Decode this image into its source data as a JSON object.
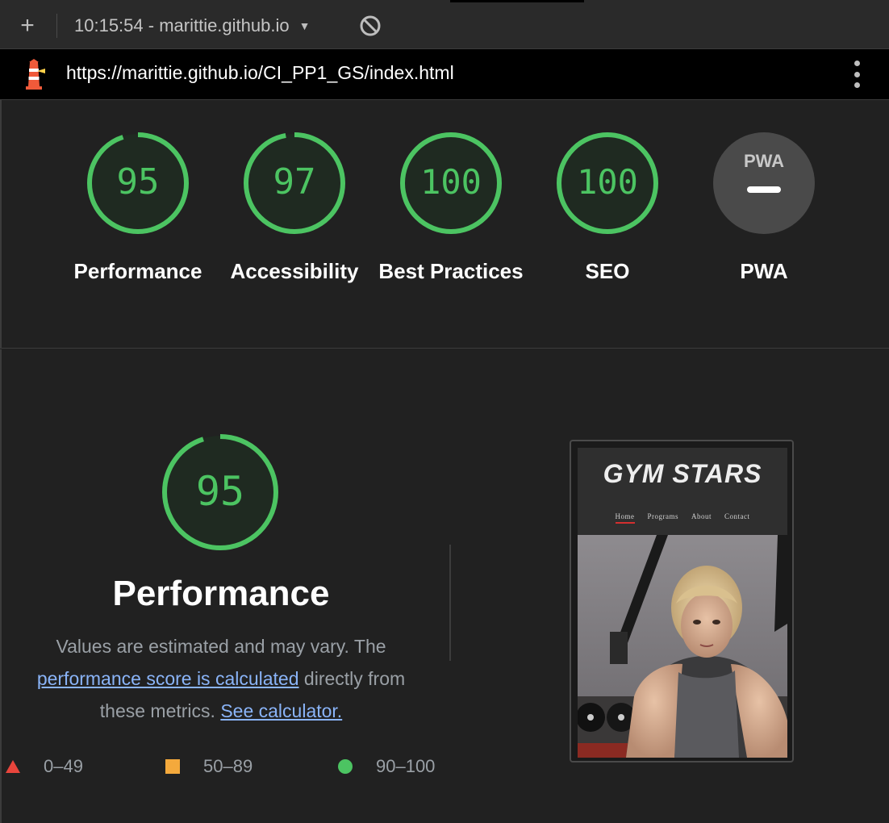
{
  "toolbar": {
    "add_label": "+",
    "run_label": "10:15:54 - marittie.github.io",
    "caret": "▼"
  },
  "urlbar": {
    "url": "https://marittie.github.io/CI_PP1_GS/index.html"
  },
  "scores": [
    {
      "label": "Performance",
      "value": "95"
    },
    {
      "label": "Accessibility",
      "value": "97"
    },
    {
      "label": "Best Practices",
      "value": "100"
    },
    {
      "label": "SEO",
      "value": "100"
    },
    {
      "label": "PWA",
      "value": "—",
      "badge": "PWA"
    }
  ],
  "colors": {
    "pass": "#4cc462",
    "average": "#f4a93c",
    "fail": "#e8453c",
    "link": "#8ab4f8"
  },
  "performance": {
    "score": "95",
    "title": "Performance",
    "desc_1": "Values are estimated and may vary. The",
    "desc_link_1": "performance score is calculated",
    "desc_2": " directly from these metrics. ",
    "desc_link_2": "See calculator."
  },
  "legend": [
    {
      "range": "0–49",
      "shape": "triangle"
    },
    {
      "range": "50–89",
      "shape": "square"
    },
    {
      "range": "90–100",
      "shape": "circle"
    }
  ],
  "screenshot": {
    "site_title": "GYM STARS",
    "nav": [
      "Home",
      "Programs",
      "About",
      "Contact"
    ]
  }
}
